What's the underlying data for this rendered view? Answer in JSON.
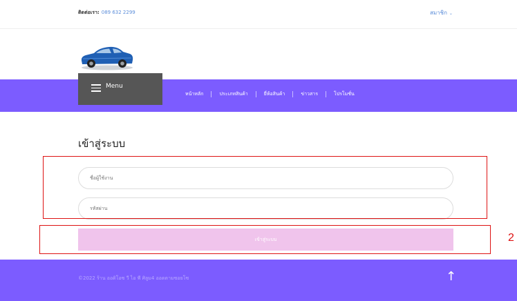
{
  "topbar": {
    "contact_label": "ติดต่อเรา:",
    "contact_phone": "089 632 2299",
    "member_label": "สมาชิก",
    "member_chevron": "chevron-down-icon"
  },
  "logo": {
    "icon": "blue-sedan-car-logo"
  },
  "nav": {
    "menu_label": "Menu",
    "menu_icon": "hamburger-icon",
    "links": [
      "หน้าหลัก",
      "ประเภทสินค้า",
      "ยี่ห้อสินค้า",
      "ข่าวสาร",
      "โปรโมชั่น"
    ]
  },
  "login": {
    "title": "เข้าสู่ระบบ",
    "username_placeholder": "ชื่อผู้ใช้งาน",
    "password_placeholder": "รหัสผ่าน",
    "submit_label": "เข้าสู่ระบบ"
  },
  "annotation": {
    "number": "2",
    "color": "#dd1111"
  },
  "footer": {
    "copyright": "©2022 ร้าน ออดิโอซ วี ไอ พี ศิลูม4 ออดตามซอยโซ",
    "scroll_top_icon": "arrow-up-icon"
  },
  "colors": {
    "brand_purple": "#7c5cff",
    "menu_box": "#565656",
    "submit_bg": "#f0c4ec",
    "link_blue": "#5b8dd9"
  }
}
